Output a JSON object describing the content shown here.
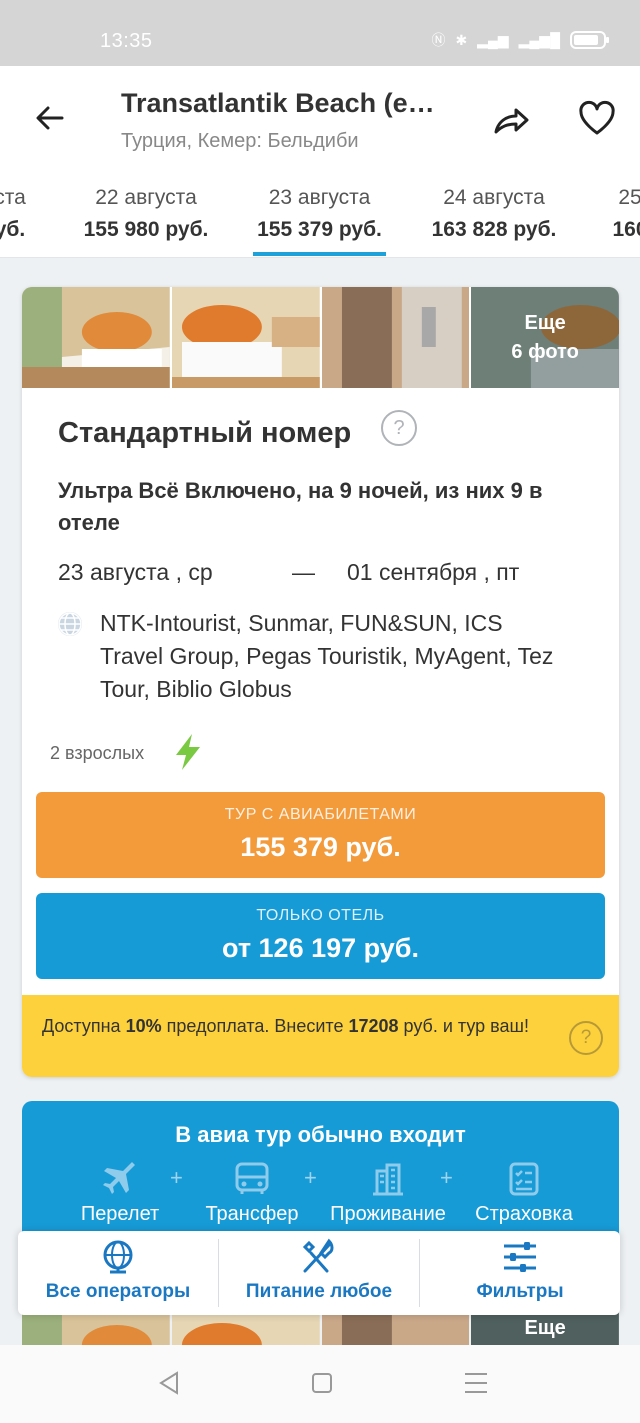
{
  "status": {
    "time": "13:35"
  },
  "header": {
    "title": "Transatlantik Beach (e…",
    "subtitle": "Турция, Кемер: Бельдиби"
  },
  "dates": [
    {
      "date": "ста",
      "price": "уб."
    },
    {
      "date": "22 августа",
      "price": "155 980 руб."
    },
    {
      "date": "23 августа",
      "price": "155 379 руб.",
      "active": true
    },
    {
      "date": "24 августа",
      "price": "163 828 руб."
    },
    {
      "date": "25",
      "price": "160"
    }
  ],
  "card": {
    "more_photos_line1": "Еще",
    "more_photos_line2": "6 фото",
    "room_title": "Стандартный номер",
    "help_mark": "?",
    "board": "Ультра Всё Включено, на 9 ночей, из них 9 в отеле",
    "date_from": "23 августа , ср",
    "dash": "—",
    "date_to": "01 сентября , пт",
    "operators": "NTK-Intourist, Sunmar, FUN&SUN, ICS Travel Group, Pegas Touristik, MyAgent, Tez Tour, Biblio Globus",
    "adults": "2 взрослых",
    "tour_label": "ТУР С АВИАБИЛЕТАМИ",
    "tour_price": "155 379 руб.",
    "hotel_label": "ТОЛЬКО ОТЕЛЬ",
    "hotel_price": "от 126 197 руб.",
    "prepay_1": "Доступна ",
    "prepay_pct": "10%",
    "prepay_2": " предоплата. Внесите ",
    "prepay_sum": "17208",
    "prepay_3": " руб. и тур ваш!"
  },
  "avia": {
    "title": "В авиа тур обычно входит",
    "items": [
      "Перелет",
      "Трансфер",
      "Проживание",
      "Страховка"
    ],
    "plus": "+"
  },
  "photos2_more": "Еще",
  "bottom_bar": [
    {
      "label": "Все операторы",
      "icon": "globe-icon"
    },
    {
      "label": "Питание любое",
      "icon": "fork-knife-icon"
    },
    {
      "label": "Фильтры",
      "icon": "sliders-icon"
    }
  ],
  "colors": {
    "orange": "#f39a3b",
    "blue": "#179bd7",
    "yellow": "#fdd13c",
    "accent": "#1a78c2"
  }
}
